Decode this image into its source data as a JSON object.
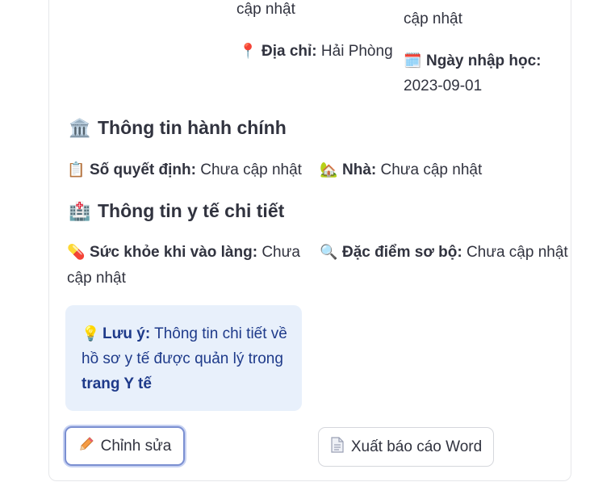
{
  "profile": {
    "top_left_fragment": "cập nhật",
    "top_right_fragment": "cập nhật",
    "address_label": "Địa chỉ:",
    "address_value": "Hải Phòng",
    "enroll_label": "Ngày nhập học:",
    "enroll_value": "2023-09-01"
  },
  "admin_section": {
    "title": "Thông tin hành chính",
    "decision_label": "Số quyết định:",
    "decision_value": "Chưa cập nhật",
    "house_label": "Nhà:",
    "house_value": "Chưa cập nhật"
  },
  "medical_section": {
    "title": "Thông tin y tế chi tiết",
    "health_label": "Sức khỏe khi vào làng:",
    "health_value": "Chưa cập nhật",
    "traits_label": "Đặc điểm sơ bộ:",
    "traits_value": "Chưa cập nhật"
  },
  "note": {
    "label": "Lưu ý:",
    "text": "Thông tin chi tiết về hồ sơ y tế được quản lý trong",
    "link": "trang Y tế"
  },
  "buttons": {
    "edit": "Chỉnh sửa",
    "export": "Xuất báo cáo Word"
  },
  "icons": {
    "pin": "pin-icon",
    "calendar": "calendar-icon",
    "building": "classical-building-icon",
    "clipboard": "clipboard-icon",
    "house": "house-icon",
    "hospital": "hospital-icon",
    "pill": "pill-icon",
    "magnifier": "magnifier-icon",
    "bulb": "light-bulb-icon",
    "pencil": "pencil-icon",
    "document": "document-icon"
  },
  "colors": {
    "note_bg": "#e8f0fb",
    "note_text": "#1e3a8a",
    "focus_ring": "#7b8fd1"
  }
}
